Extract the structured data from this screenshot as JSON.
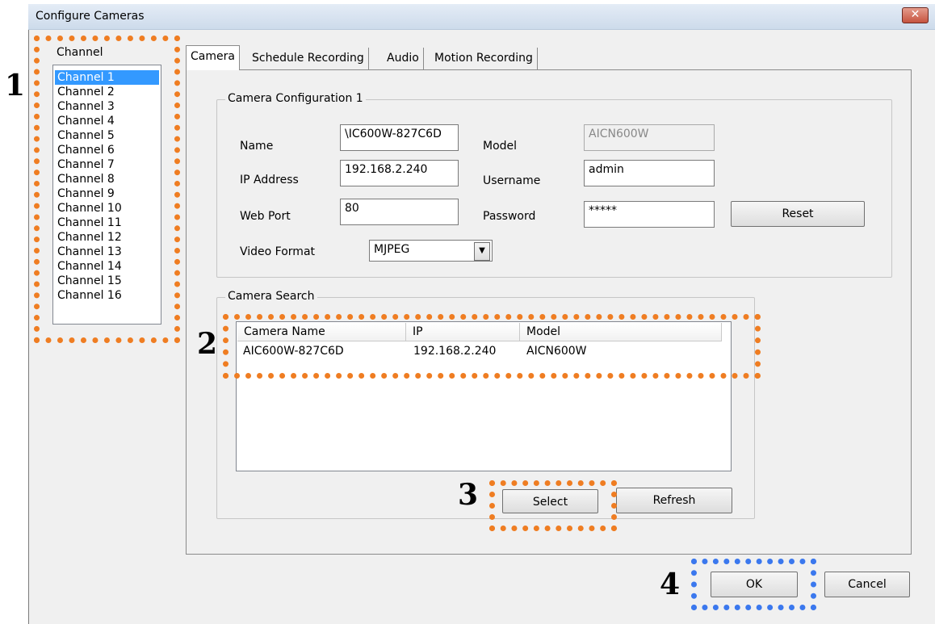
{
  "window": {
    "title": "Configure Cameras",
    "close_glyph": "✕"
  },
  "channel_panel": {
    "label": "Channel",
    "items": [
      "Channel 1",
      "Channel 2",
      "Channel 3",
      "Channel 4",
      "Channel 5",
      "Channel 6",
      "Channel 7",
      "Channel 8",
      "Channel 9",
      "Channel 10",
      "Channel 11",
      "Channel 12",
      "Channel 13",
      "Channel 14",
      "Channel 15",
      "Channel 16"
    ],
    "selected_index": 0
  },
  "tabs": [
    {
      "label": "Camera",
      "active": true
    },
    {
      "label": "Schedule Recording",
      "active": false
    },
    {
      "label": "Audio",
      "active": false
    },
    {
      "label": "Motion Recording",
      "active": false
    }
  ],
  "config": {
    "group_title": "Camera Configuration 1",
    "name_label": "Name",
    "name_value": "\\IC600W-827C6D",
    "model_label": "Model",
    "model_value": "AICN600W",
    "ip_label": "IP Address",
    "ip_value": "192.168.2.240",
    "username_label": "Username",
    "username_value": "admin",
    "port_label": "Web Port",
    "port_value": "80",
    "password_label": "Password",
    "password_value": "*****",
    "reset_label": "Reset",
    "format_label": "Video Format",
    "format_value": "MJPEG",
    "format_arrow": "▼"
  },
  "search": {
    "group_title": "Camera Search",
    "columns": [
      "Camera Name",
      "IP",
      "Model"
    ],
    "rows": [
      {
        "name": "AIC600W-827C6D",
        "ip": "192.168.2.240",
        "model": "AICN600W"
      }
    ],
    "select_label": "Select",
    "refresh_label": "Refresh"
  },
  "footer": {
    "ok_label": "OK",
    "cancel_label": "Cancel"
  },
  "callouts": [
    "1",
    "2",
    "3",
    "4"
  ],
  "colors": {
    "callout_orange": "#ef7d22",
    "callout_blue": "#3b78ee",
    "selection": "#3399ff"
  }
}
